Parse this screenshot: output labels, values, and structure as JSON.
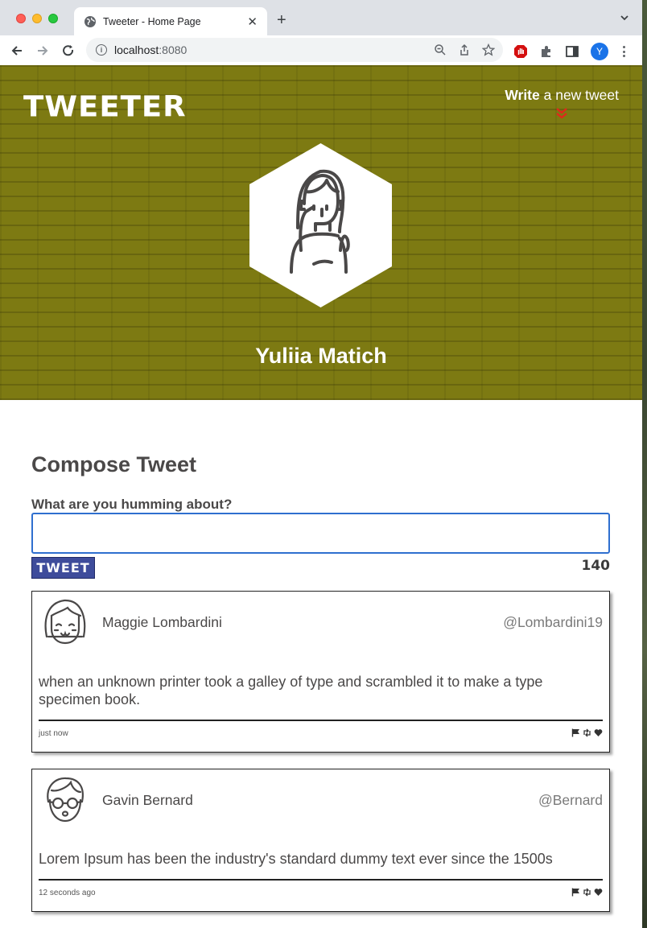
{
  "browser": {
    "tab_title": "Tweeter - Home Page",
    "url_host": "localhost",
    "url_port": ":8080",
    "profile_initial": "Y"
  },
  "header": {
    "logo": "TWEETER",
    "write_bold": "Write",
    "write_rest": " a new tweet",
    "user_name": "Yuliia Matich",
    "hero_color": "#7d7a12",
    "accent_chevron_color": "#e0281b"
  },
  "compose": {
    "title": "Compose Tweet",
    "question": "What are you humming about?",
    "input_value": "",
    "tweet_button": "TWEET",
    "counter": "140",
    "button_color": "#3e4c9b"
  },
  "tweets": [
    {
      "name": "Maggie Lombardini",
      "handle": "@Lombardini19",
      "text": "when an unknown printer took a galley of type and scrambled it to make a type specimen book.",
      "time": "just now",
      "avatar": "girl-bangs-avatar"
    },
    {
      "name": "Gavin Bernard",
      "handle": "@Bernard",
      "text": "Lorem Ipsum has been the industry's standard dummy text ever since the 1500s",
      "time": "12 seconds ago",
      "avatar": "man-glasses-avatar"
    }
  ]
}
